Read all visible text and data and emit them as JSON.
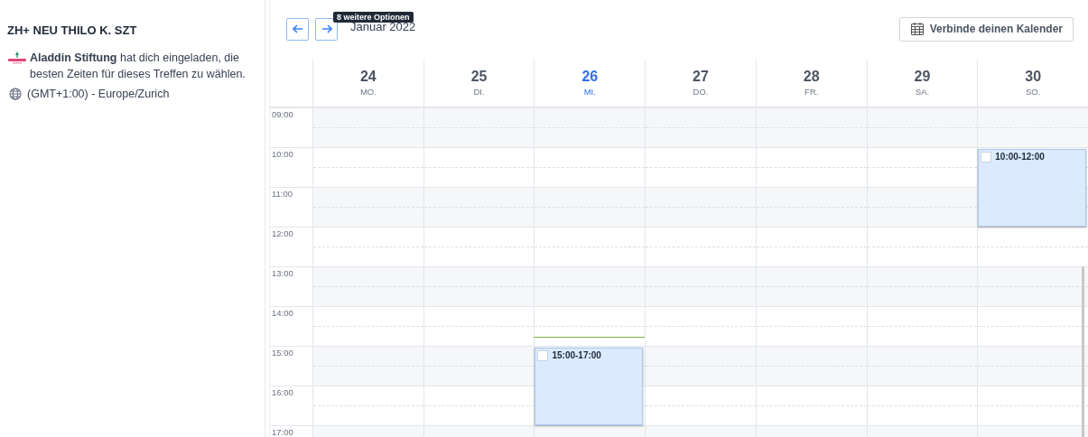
{
  "meeting": {
    "title": "ZH+ NEU THILO K. SZT",
    "invitation": "**Aladdin Stiftung** hat dich eingeladen, die besten Zeiten für dieses Treffen zu wählen.",
    "timezone": "(GMT+1:00) - Europe/Zurich"
  },
  "toolbar": {
    "tooltip": "8 weitere Optionen",
    "month": "Januar 2022",
    "connect_button": "Verbinde deinen Kalender"
  },
  "days": [
    {
      "date": "24",
      "weekday": "MO.",
      "today": false
    },
    {
      "date": "25",
      "weekday": "DI.",
      "today": false
    },
    {
      "date": "26",
      "weekday": "MI.",
      "today": true,
      "events": [
        {
          "time": "15:00-17:00",
          "checked": false
        }
      ]
    },
    {
      "date": "27",
      "weekday": "DO.",
      "today": false
    },
    {
      "date": "28",
      "weekday": "FR.",
      "today": false
    },
    {
      "date": "29",
      "weekday": "SA.",
      "today": false
    },
    {
      "date": "30",
      "weekday": "SO.",
      "today": false,
      "events": [
        {
          "time": "10:00-12:00",
          "checked": false
        }
      ]
    }
  ],
  "hours": [
    "09:00",
    "10:00",
    "11:00",
    "12:00",
    "13:00",
    "14:00",
    "15:00",
    "16:00",
    "17:00"
  ]
}
